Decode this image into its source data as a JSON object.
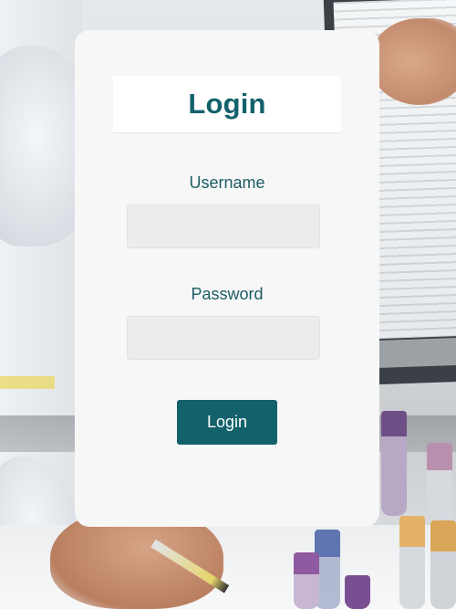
{
  "login_form": {
    "title": "Login",
    "username_label": "Username",
    "username_value": "",
    "username_placeholder": "",
    "password_label": "Password",
    "password_value": "",
    "password_placeholder": "",
    "submit_label": "Login"
  },
  "colors": {
    "accent": "#13616a",
    "card_background": "#f7f7f7",
    "input_background": "#ececec"
  },
  "background": {
    "description_icon": "laboratory-photo"
  }
}
